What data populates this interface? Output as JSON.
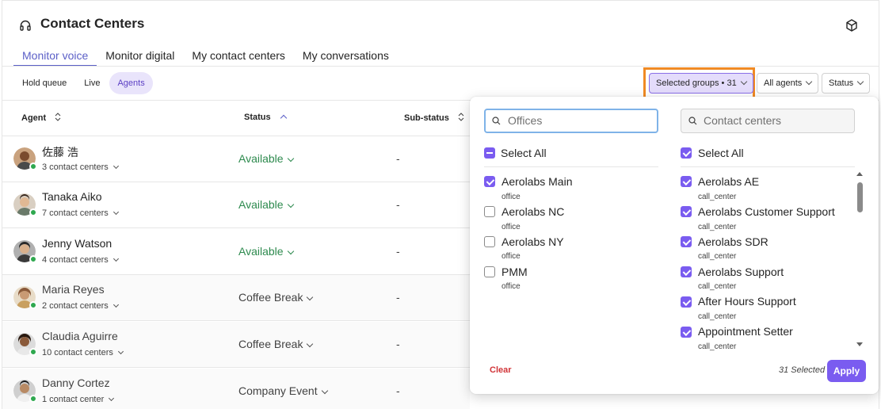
{
  "header": {
    "title": "Contact Centers",
    "app_icon": "headset-icon",
    "right_icon": "cube-icon"
  },
  "tabs": [
    {
      "label": "Monitor voice",
      "active": true
    },
    {
      "label": "Monitor digital",
      "active": false
    },
    {
      "label": "My contact centers",
      "active": false
    },
    {
      "label": "My conversations",
      "active": false
    }
  ],
  "subtabs": [
    {
      "label": "Hold queue",
      "active": false
    },
    {
      "label": "Live",
      "active": false
    },
    {
      "label": "Agents",
      "active": true
    }
  ],
  "filters": {
    "groups": "Selected groups • 31",
    "agents": "All agents",
    "status": "Status"
  },
  "table": {
    "columns": {
      "agent": "Agent",
      "status": "Status",
      "substatus": "Sub-status"
    },
    "rows": [
      {
        "name": "佐藤 浩",
        "centers": "3 contact centers",
        "status": "Available",
        "substatus": "-",
        "kind": "available"
      },
      {
        "name": "Tanaka Aiko",
        "centers": "7 contact centers",
        "status": "Available",
        "substatus": "-",
        "kind": "available"
      },
      {
        "name": "Jenny Watson",
        "centers": "4 contact centers",
        "status": "Available",
        "substatus": "-",
        "kind": "available"
      },
      {
        "name": "Maria Reyes",
        "centers": "2 contact centers",
        "status": "Coffee Break",
        "substatus": "-",
        "kind": "other"
      },
      {
        "name": "Claudia Aguirre",
        "centers": "10 contact centers",
        "status": "Coffee Break",
        "substatus": "-",
        "kind": "other"
      },
      {
        "name": "Danny Cortez",
        "centers": "1 contact center",
        "status": "Company Event",
        "substatus": "-",
        "kind": "other"
      }
    ]
  },
  "panel": {
    "offices_placeholder": "Offices",
    "centers_placeholder": "Contact centers",
    "offices_select_all": "Select All",
    "centers_select_all": "Select All",
    "offices": [
      {
        "name": "Aerolabs Main",
        "type": "office",
        "checked": true
      },
      {
        "name": "Aerolabs NC",
        "type": "office",
        "checked": false
      },
      {
        "name": "Aerolabs NY",
        "type": "office",
        "checked": false
      },
      {
        "name": "PMM",
        "type": "office",
        "checked": false
      }
    ],
    "centers": [
      {
        "name": "Aerolabs AE",
        "type": "call_center",
        "checked": true
      },
      {
        "name": "Aerolabs Customer Support",
        "type": "call_center",
        "checked": true
      },
      {
        "name": "Aerolabs SDR",
        "type": "call_center",
        "checked": true
      },
      {
        "name": "Aerolabs Support",
        "type": "call_center",
        "checked": true
      },
      {
        "name": "After Hours Support",
        "type": "call_center",
        "checked": true
      },
      {
        "name": "Appointment Setter",
        "type": "call_center",
        "checked": true
      }
    ],
    "clear_label": "Clear",
    "selected_count": "31 Selected",
    "apply_label": "Apply"
  },
  "colors": {
    "accent": "#7a5cf0",
    "available": "#2d8a4e",
    "highlight": "#f08a24",
    "clear": "#d13438"
  }
}
